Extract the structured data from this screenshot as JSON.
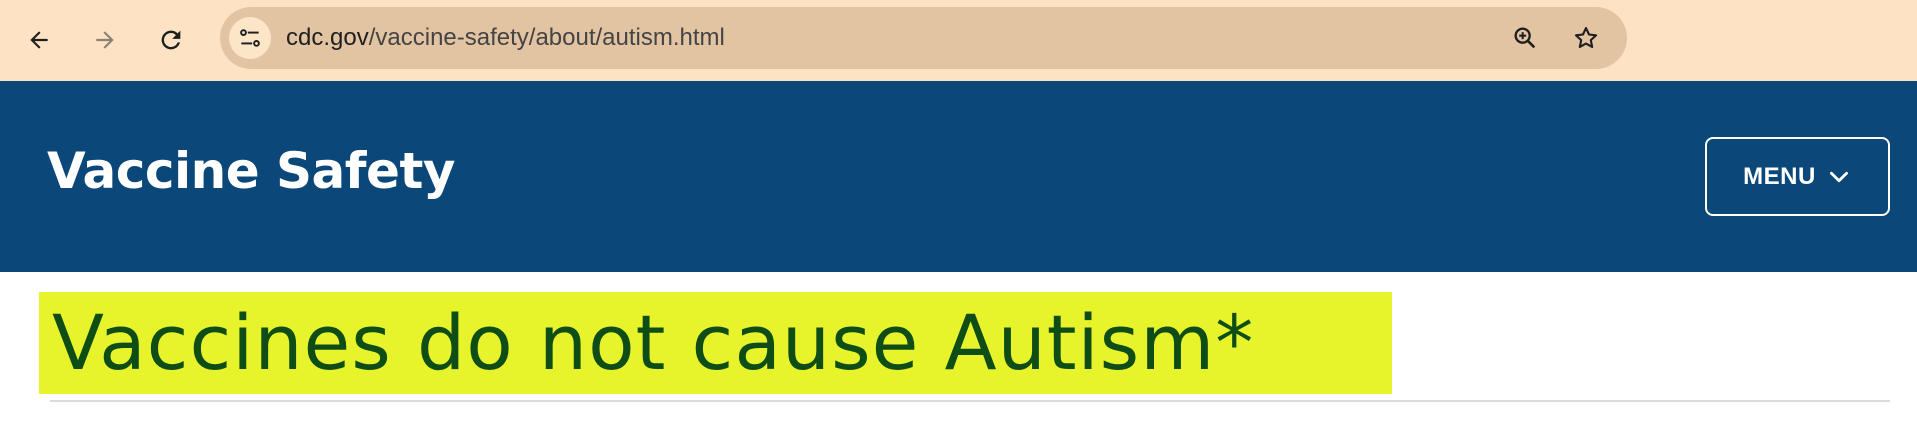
{
  "browser": {
    "url_domain": "cdc.gov",
    "url_path": "/vaccine-safety/about/autism.html",
    "icons": [
      "back-arrow-icon",
      "forward-arrow-icon",
      "reload-icon",
      "site-info-icon",
      "zoom-icon",
      "bookmark-star-icon"
    ]
  },
  "header": {
    "site_title": "Vaccine Safety",
    "menu_label": "MENU",
    "menu_icon": "chevron-down-icon"
  },
  "main": {
    "page_title": "Vaccines do not cause Autism*"
  },
  "colors": {
    "browser_bar": "#fde3c4",
    "omnibox": "#e2c4a3",
    "header_bg": "#0b4778",
    "title_highlight": "#e7f42b",
    "title_text": "#0f4d17"
  }
}
